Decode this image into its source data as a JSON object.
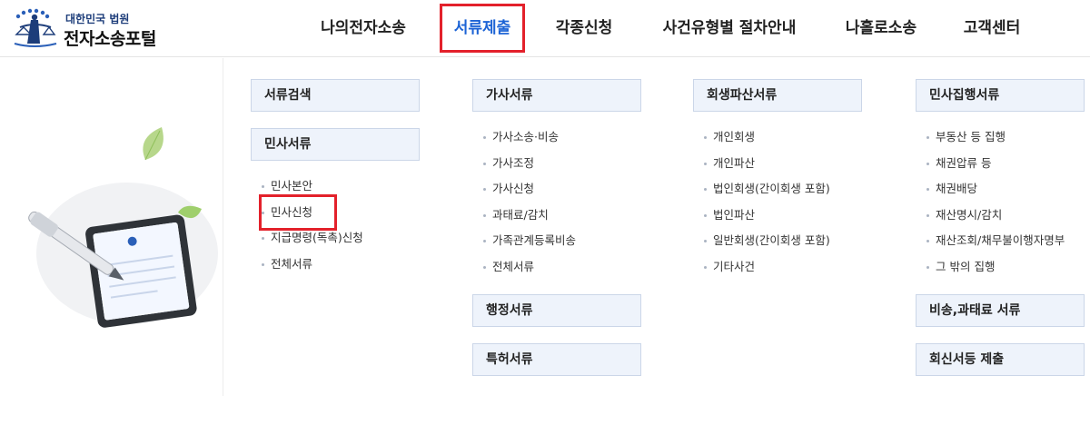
{
  "logo": {
    "subtitle": "대한민국 법원",
    "title": "전자소송포털"
  },
  "gnb": [
    {
      "label": "나의전자소송",
      "active": false
    },
    {
      "label": "서류제출",
      "active": true
    },
    {
      "label": "각종신청",
      "active": false
    },
    {
      "label": "사건유형별 절차안내",
      "active": false
    },
    {
      "label": "나홀로소송",
      "active": false
    },
    {
      "label": "고객센터",
      "active": false
    }
  ],
  "col1": {
    "search_label": "서류검색",
    "civil": {
      "label": "민사서류",
      "items": [
        "민사본안",
        "민사신청",
        "지급명령(독촉)신청",
        "전체서류"
      ]
    }
  },
  "col2": {
    "family": {
      "label": "가사서류",
      "items": [
        "가사소송·비송",
        "가사조정",
        "가사신청",
        "과태료/감치",
        "가족관계등록비송",
        "전체서류"
      ]
    },
    "admin_label": "행정서류",
    "patent_label": "특허서류"
  },
  "col3": {
    "rehab": {
      "label": "회생파산서류",
      "items": [
        "개인회생",
        "개인파산",
        "법인회생(간이회생 포함)",
        "법인파산",
        "일반회생(간이회생 포함)",
        "기타사건"
      ]
    }
  },
  "col4": {
    "execution": {
      "label": "민사집행서류",
      "items": [
        "부동산 등 집행",
        "채권압류 등",
        "채권배당",
        "재산명시/감치",
        "재산조회/채무불이행자명부",
        "그 밖의 집행"
      ]
    },
    "nonlit_label": "비송,과태료 서류",
    "reply_label": "회신서등 제출"
  },
  "colors": {
    "active": "#1c63d5",
    "highlight": "#e3212b",
    "header_bg": "#eef3fb",
    "header_border": "#cbd6e8"
  },
  "icons": {
    "logo": "court-justice-emblem",
    "illustration": "tablet-with-pen-and-leaves"
  }
}
